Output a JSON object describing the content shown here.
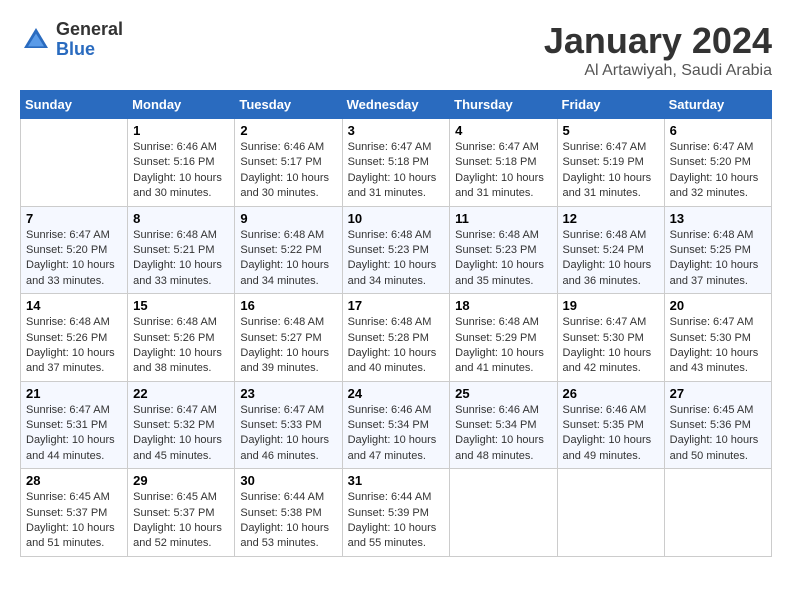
{
  "header": {
    "logo_general": "General",
    "logo_blue": "Blue",
    "month_title": "January 2024",
    "subtitle": "Al Artawiyah, Saudi Arabia"
  },
  "days_of_week": [
    "Sunday",
    "Monday",
    "Tuesday",
    "Wednesday",
    "Thursday",
    "Friday",
    "Saturday"
  ],
  "weeks": [
    [
      {
        "day": "",
        "info": ""
      },
      {
        "day": "1",
        "info": "Sunrise: 6:46 AM\nSunset: 5:16 PM\nDaylight: 10 hours\nand 30 minutes."
      },
      {
        "day": "2",
        "info": "Sunrise: 6:46 AM\nSunset: 5:17 PM\nDaylight: 10 hours\nand 30 minutes."
      },
      {
        "day": "3",
        "info": "Sunrise: 6:47 AM\nSunset: 5:18 PM\nDaylight: 10 hours\nand 31 minutes."
      },
      {
        "day": "4",
        "info": "Sunrise: 6:47 AM\nSunset: 5:18 PM\nDaylight: 10 hours\nand 31 minutes."
      },
      {
        "day": "5",
        "info": "Sunrise: 6:47 AM\nSunset: 5:19 PM\nDaylight: 10 hours\nand 31 minutes."
      },
      {
        "day": "6",
        "info": "Sunrise: 6:47 AM\nSunset: 5:20 PM\nDaylight: 10 hours\nand 32 minutes."
      }
    ],
    [
      {
        "day": "7",
        "info": "Sunrise: 6:47 AM\nSunset: 5:20 PM\nDaylight: 10 hours\nand 33 minutes."
      },
      {
        "day": "8",
        "info": "Sunrise: 6:48 AM\nSunset: 5:21 PM\nDaylight: 10 hours\nand 33 minutes."
      },
      {
        "day": "9",
        "info": "Sunrise: 6:48 AM\nSunset: 5:22 PM\nDaylight: 10 hours\nand 34 minutes."
      },
      {
        "day": "10",
        "info": "Sunrise: 6:48 AM\nSunset: 5:23 PM\nDaylight: 10 hours\nand 34 minutes."
      },
      {
        "day": "11",
        "info": "Sunrise: 6:48 AM\nSunset: 5:23 PM\nDaylight: 10 hours\nand 35 minutes."
      },
      {
        "day": "12",
        "info": "Sunrise: 6:48 AM\nSunset: 5:24 PM\nDaylight: 10 hours\nand 36 minutes."
      },
      {
        "day": "13",
        "info": "Sunrise: 6:48 AM\nSunset: 5:25 PM\nDaylight: 10 hours\nand 37 minutes."
      }
    ],
    [
      {
        "day": "14",
        "info": "Sunrise: 6:48 AM\nSunset: 5:26 PM\nDaylight: 10 hours\nand 37 minutes."
      },
      {
        "day": "15",
        "info": "Sunrise: 6:48 AM\nSunset: 5:26 PM\nDaylight: 10 hours\nand 38 minutes."
      },
      {
        "day": "16",
        "info": "Sunrise: 6:48 AM\nSunset: 5:27 PM\nDaylight: 10 hours\nand 39 minutes."
      },
      {
        "day": "17",
        "info": "Sunrise: 6:48 AM\nSunset: 5:28 PM\nDaylight: 10 hours\nand 40 minutes."
      },
      {
        "day": "18",
        "info": "Sunrise: 6:48 AM\nSunset: 5:29 PM\nDaylight: 10 hours\nand 41 minutes."
      },
      {
        "day": "19",
        "info": "Sunrise: 6:47 AM\nSunset: 5:30 PM\nDaylight: 10 hours\nand 42 minutes."
      },
      {
        "day": "20",
        "info": "Sunrise: 6:47 AM\nSunset: 5:30 PM\nDaylight: 10 hours\nand 43 minutes."
      }
    ],
    [
      {
        "day": "21",
        "info": "Sunrise: 6:47 AM\nSunset: 5:31 PM\nDaylight: 10 hours\nand 44 minutes."
      },
      {
        "day": "22",
        "info": "Sunrise: 6:47 AM\nSunset: 5:32 PM\nDaylight: 10 hours\nand 45 minutes."
      },
      {
        "day": "23",
        "info": "Sunrise: 6:47 AM\nSunset: 5:33 PM\nDaylight: 10 hours\nand 46 minutes."
      },
      {
        "day": "24",
        "info": "Sunrise: 6:46 AM\nSunset: 5:34 PM\nDaylight: 10 hours\nand 47 minutes."
      },
      {
        "day": "25",
        "info": "Sunrise: 6:46 AM\nSunset: 5:34 PM\nDaylight: 10 hours\nand 48 minutes."
      },
      {
        "day": "26",
        "info": "Sunrise: 6:46 AM\nSunset: 5:35 PM\nDaylight: 10 hours\nand 49 minutes."
      },
      {
        "day": "27",
        "info": "Sunrise: 6:45 AM\nSunset: 5:36 PM\nDaylight: 10 hours\nand 50 minutes."
      }
    ],
    [
      {
        "day": "28",
        "info": "Sunrise: 6:45 AM\nSunset: 5:37 PM\nDaylight: 10 hours\nand 51 minutes."
      },
      {
        "day": "29",
        "info": "Sunrise: 6:45 AM\nSunset: 5:37 PM\nDaylight: 10 hours\nand 52 minutes."
      },
      {
        "day": "30",
        "info": "Sunrise: 6:44 AM\nSunset: 5:38 PM\nDaylight: 10 hours\nand 53 minutes."
      },
      {
        "day": "31",
        "info": "Sunrise: 6:44 AM\nSunset: 5:39 PM\nDaylight: 10 hours\nand 55 minutes."
      },
      {
        "day": "",
        "info": ""
      },
      {
        "day": "",
        "info": ""
      },
      {
        "day": "",
        "info": ""
      }
    ]
  ]
}
